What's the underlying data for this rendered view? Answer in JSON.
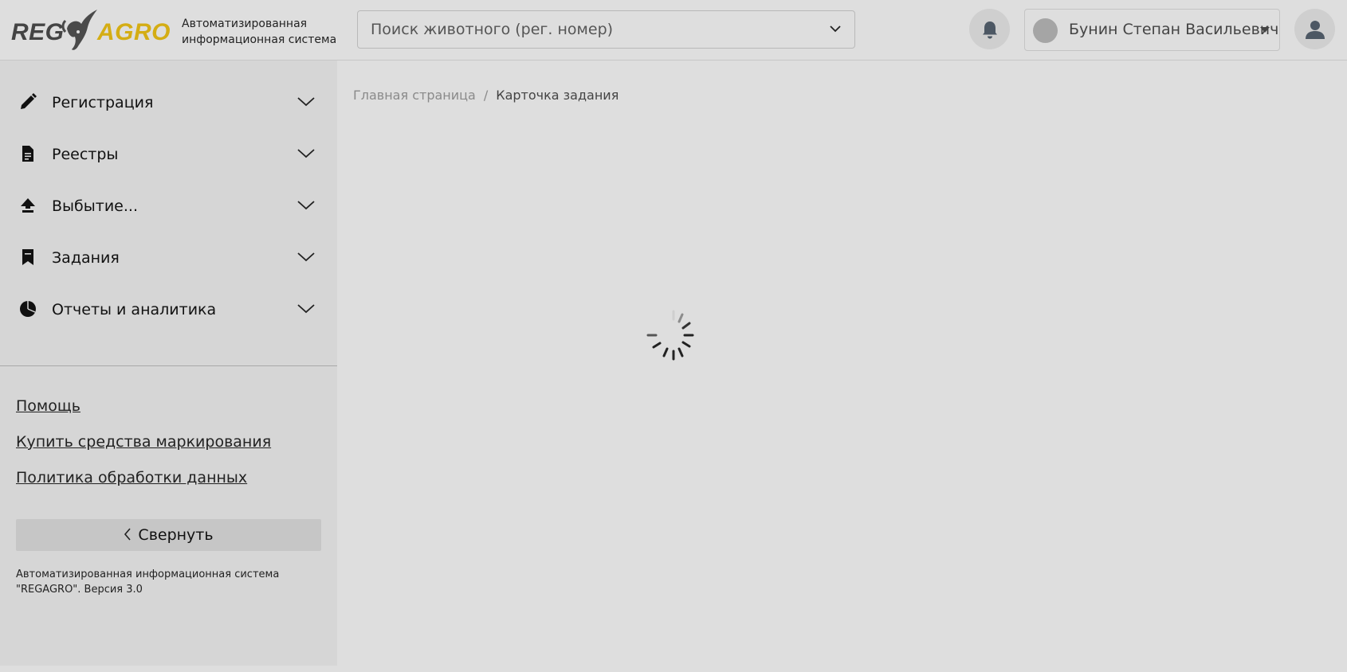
{
  "header": {
    "logo_part1": "REG",
    "logo_part2": "AGRO",
    "subtitle_line1": "Автоматизированная",
    "subtitle_line2": "информационная система",
    "search_placeholder": "Поиск животного (рег. номер)",
    "user_name": "Бунин Степан Васильевич"
  },
  "sidebar": {
    "items": [
      {
        "label": "Регистрация",
        "icon": "pencil-icon"
      },
      {
        "label": "Реестры",
        "icon": "document-icon"
      },
      {
        "label": "Выбытие...",
        "icon": "upload-arrow-icon"
      },
      {
        "label": "Задания",
        "icon": "bookmark-icon"
      },
      {
        "label": "Отчеты и аналитика",
        "icon": "pie-chart-icon"
      }
    ],
    "links": {
      "help": "Помощь",
      "buy_marking": "Купить средства маркирования",
      "data_policy": "Политика обработки данных"
    },
    "collapse_label": "Свернуть",
    "footer_line1": "Автоматизированная информационная система",
    "footer_line2": "\"REGAGRO\". Версия 3.0"
  },
  "breadcrumb": {
    "home": "Главная страница",
    "separator": "/",
    "current": "Карточка задания"
  },
  "colors": {
    "logo_accent": "#d4ad14",
    "background": "#dedede",
    "sidebar_bg": "#d6d6d6"
  }
}
